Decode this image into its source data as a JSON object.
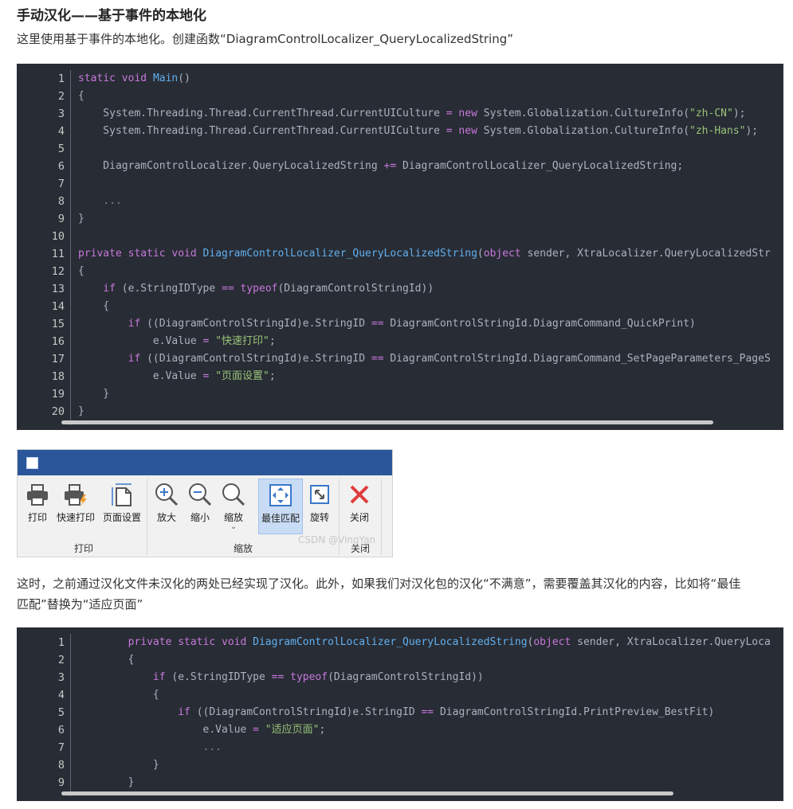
{
  "heading": "手动汉化——基于事件的本地化",
  "intro": "这里使用基于事件的本地化。创建函数“DiagramControlLocalizer_QueryLocalizedString”",
  "code1": {
    "line_numbers": [
      "1",
      "2",
      "3",
      "4",
      "5",
      "6",
      "7",
      "8",
      "9",
      "10",
      "11",
      "12",
      "13",
      "14",
      "15",
      "16",
      "17",
      "18",
      "19",
      "20"
    ],
    "tokens": [
      [
        [
          "kw",
          "static"
        ],
        [
          "",
          ""
        ],
        [
          "kw",
          " void "
        ],
        [
          "fn",
          "Main"
        ],
        [
          "",
          "()"
        ]
      ],
      [
        [
          "",
          "{"
        ]
      ],
      [
        [
          "",
          "    System.Threading.Thread.CurrentThread.CurrentUICulture "
        ],
        [
          "op",
          "="
        ],
        [
          "kw",
          " new"
        ],
        [
          "",
          " System.Globalization.CultureInfo("
        ],
        [
          "st",
          "\"zh-CN\""
        ],
        [
          "",
          ");"
        ]
      ],
      [
        [
          "",
          "    System.Threading.Thread.CurrentThread.CurrentUICulture "
        ],
        [
          "op",
          "="
        ],
        [
          "kw",
          " new"
        ],
        [
          "",
          " System.Globalization.CultureInfo("
        ],
        [
          "st",
          "\"zh-Hans\""
        ],
        [
          "",
          ");"
        ]
      ],
      [
        [
          "",
          ""
        ]
      ],
      [
        [
          "",
          "    DiagramControlLocalizer.QueryLocalizedString "
        ],
        [
          "op",
          "+="
        ],
        [
          "",
          " DiagramControlLocalizer_QueryLocalizedString;"
        ]
      ],
      [
        [
          "",
          ""
        ]
      ],
      [
        [
          "cm",
          "    ..."
        ]
      ],
      [
        [
          "",
          "}"
        ]
      ],
      [
        [
          "",
          ""
        ]
      ],
      [
        [
          "kw",
          "private static void "
        ],
        [
          "fn",
          "DiagramControlLocalizer_QueryLocalizedString"
        ],
        [
          "",
          "("
        ],
        [
          "kw",
          "object"
        ],
        [
          "",
          " sender, XtraLocalizer.QueryLocalizedStringEventArgs e)"
        ]
      ],
      [
        [
          "",
          "{"
        ]
      ],
      [
        [
          "kw",
          "    if"
        ],
        [
          "",
          " (e.StringIDType "
        ],
        [
          "op",
          "=="
        ],
        [
          "kw",
          " typeof"
        ],
        [
          "",
          "(DiagramControlStringId))"
        ]
      ],
      [
        [
          "",
          "    {"
        ]
      ],
      [
        [
          "kw",
          "        if"
        ],
        [
          "",
          " ((DiagramControlStringId)e.StringID "
        ],
        [
          "op",
          "=="
        ],
        [
          "",
          " DiagramControlStringId.DiagramCommand_QuickPrint)"
        ]
      ],
      [
        [
          "",
          "            e.Value "
        ],
        [
          "op",
          "="
        ],
        [
          "st",
          " \"快速打印\""
        ],
        [
          "",
          ";"
        ]
      ],
      [
        [
          "kw",
          "        if"
        ],
        [
          "",
          " ((DiagramControlStringId)e.StringID "
        ],
        [
          "op",
          "=="
        ],
        [
          "",
          " DiagramControlStringId.DiagramCommand_SetPageParameters_PageSize_Header)"
        ]
      ],
      [
        [
          "",
          "            e.Value "
        ],
        [
          "op",
          "="
        ],
        [
          "st",
          " \"页面设置\""
        ],
        [
          "",
          ";"
        ]
      ],
      [
        [
          "",
          "    }"
        ]
      ],
      [
        [
          "",
          "}"
        ]
      ]
    ]
  },
  "ribbon": {
    "buttons": [
      {
        "label": "打印",
        "icon": "printer-icon"
      },
      {
        "label": "快速打印",
        "icon": "quick-print-icon"
      },
      {
        "label": "页面设置",
        "icon": "page-setup-icon"
      },
      {
        "label": "放大",
        "icon": "zoom-in-icon"
      },
      {
        "label": "缩小",
        "icon": "zoom-out-icon"
      },
      {
        "label": "缩放",
        "icon": "zoom-icon"
      },
      {
        "label": "最佳匹配",
        "icon": "best-fit-icon"
      },
      {
        "label": "旋转",
        "icon": "rotate-icon"
      },
      {
        "label": "关闭",
        "icon": "close-icon"
      }
    ],
    "groups": [
      "打印",
      "缩放",
      "关闭"
    ],
    "watermark": "CSDN @VingYan",
    "colors": {
      "titlebar": "#2b579a",
      "active": "#c9dcf5",
      "close": "#e03c3c"
    }
  },
  "paragraph2_line1": "这时，之前通过汉化文件未汉化的两处已经实现了汉化。此外，如果我们对汉化包的汉化“不满意”，需要覆盖其汉化的内容，比如将“最佳",
  "paragraph2_line2": "匹配”替换为“适应页面”",
  "code2": {
    "line_numbers": [
      "1",
      "2",
      "3",
      "4",
      "5",
      "6",
      "7",
      "8",
      "9"
    ],
    "tokens": [
      [
        [
          "kw",
          "        private static void "
        ],
        [
          "fn",
          "DiagramControlLocalizer_QueryLocalizedString"
        ],
        [
          "",
          "("
        ],
        [
          "kw",
          "object"
        ],
        [
          "",
          " sender, XtraLocalizer.QueryLocalizedStringEventArgs e)"
        ]
      ],
      [
        [
          "",
          "        {"
        ]
      ],
      [
        [
          "kw",
          "            if"
        ],
        [
          "",
          " (e.StringIDType "
        ],
        [
          "op",
          "=="
        ],
        [
          "kw",
          " typeof"
        ],
        [
          "",
          "(DiagramControlStringId))"
        ]
      ],
      [
        [
          "",
          "            {"
        ]
      ],
      [
        [
          "kw",
          "                if"
        ],
        [
          "",
          " ((DiagramControlStringId)e.StringID "
        ],
        [
          "op",
          "=="
        ],
        [
          "",
          " DiagramControlStringId.PrintPreview_BestFit)"
        ]
      ],
      [
        [
          "",
          "                    e.Value "
        ],
        [
          "op",
          "="
        ],
        [
          "st",
          " \"适应页面\""
        ],
        [
          "",
          ";"
        ]
      ],
      [
        [
          "cm",
          "                    ..."
        ]
      ],
      [
        [
          "",
          "            }"
        ]
      ],
      [
        [
          "",
          "        }"
        ]
      ]
    ]
  }
}
